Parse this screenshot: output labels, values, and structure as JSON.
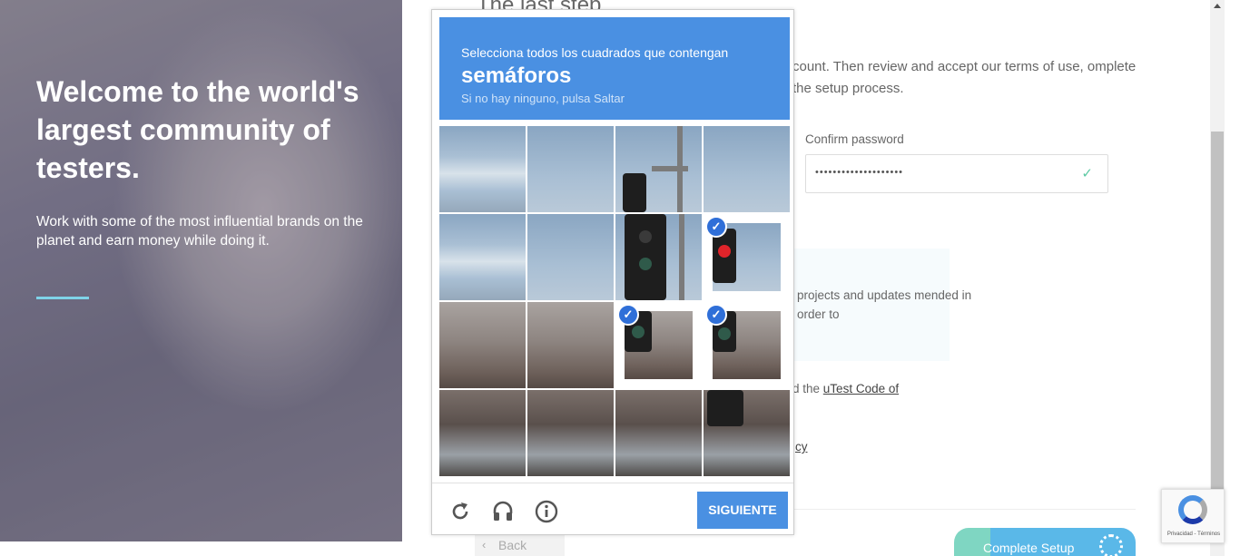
{
  "hero": {
    "title": "Welcome to the world's largest community of testers.",
    "subtitle": "Work with some of the most influential brands on the planet and earn money while doing it."
  },
  "form": {
    "title": "The last step",
    "description": "count. Then review and accept our terms of use, omplete the setup process.",
    "confirm_password_label": "Confirm password",
    "confirm_password_value": "••••••••••••••••••••",
    "newsletter_text": "projects and updates mended in order to",
    "code_prefix": "d the",
    "code_link": "uTest Code of",
    "privacy_link": "cy",
    "back_label": "Back",
    "complete_label": "Complete Setup"
  },
  "captcha": {
    "instruction": "Selecciona todos los cuadrados que contengan",
    "object": "semáforos",
    "hint": "Si no hay ninguno, pulsa Saltar",
    "next_label": "SIGUIENTE",
    "selected_tiles": [
      7,
      10,
      11
    ],
    "icons": [
      "reload-icon",
      "audio-icon",
      "info-icon"
    ]
  },
  "badge": {
    "text": "Privacidad - Términos"
  },
  "colors": {
    "captcha_blue": "#4a90e2",
    "check_green": "#5cc9a3",
    "accent_cyan": "#7fd3e8"
  }
}
